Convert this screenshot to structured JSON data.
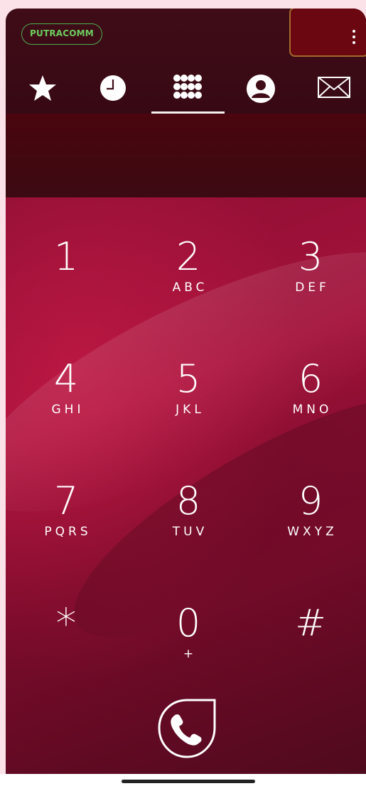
{
  "brand": {
    "label": "PUTRACOMM"
  },
  "tabs": [
    {
      "icon": "star-icon"
    },
    {
      "icon": "clock-icon"
    },
    {
      "icon": "dialpad-icon",
      "selected": true
    },
    {
      "icon": "contact-icon"
    },
    {
      "icon": "envelope-icon"
    }
  ],
  "dialer": {
    "number": ""
  },
  "keypad": [
    {
      "digit": "1",
      "letters": ""
    },
    {
      "digit": "2",
      "letters": "ABC"
    },
    {
      "digit": "3",
      "letters": "DEF"
    },
    {
      "digit": "4",
      "letters": "GHI"
    },
    {
      "digit": "5",
      "letters": "JKL"
    },
    {
      "digit": "6",
      "letters": "MNO"
    },
    {
      "digit": "7",
      "letters": "PQRS"
    },
    {
      "digit": "8",
      "letters": "TUV"
    },
    {
      "digit": "9",
      "letters": "WXYZ"
    },
    {
      "digit": "*",
      "letters": ""
    },
    {
      "digit": "0",
      "letters": "+"
    },
    {
      "digit": "#",
      "letters": ""
    }
  ],
  "colors": {
    "header": "#3f0c17",
    "accent_green": "#4caf50",
    "keypad_red": "#a4123b",
    "menu_highlight": "#6a0710"
  }
}
